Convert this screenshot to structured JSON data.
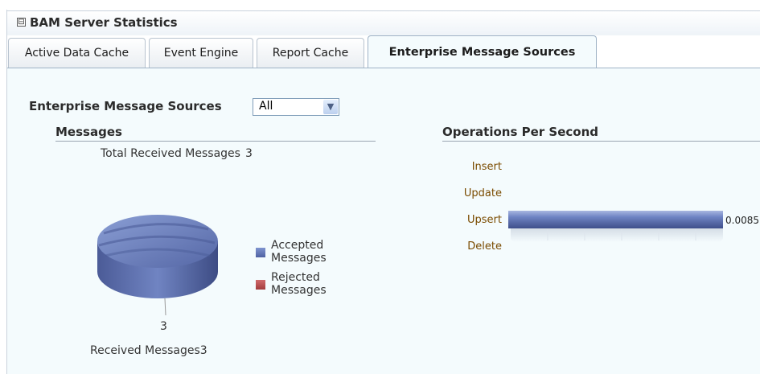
{
  "panel": {
    "title": "BAM Server Statistics",
    "collapse_glyph": "⊟"
  },
  "tabs": [
    {
      "label": "Active Data Cache",
      "selected": false
    },
    {
      "label": "Event Engine",
      "selected": false
    },
    {
      "label": "Report Cache",
      "selected": false
    },
    {
      "label": "Enterprise Message Sources",
      "selected": true
    }
  ],
  "filter": {
    "label": "Enterprise Message Sources",
    "selected_value": "All"
  },
  "messages": {
    "title": "Messages",
    "total_label": "Total Received Messages",
    "total_value": "3",
    "pie_value_label": "3",
    "pie_caption": "Received Messages3",
    "legend": [
      {
        "label": "Accepted Messages",
        "color": "#5b6fae"
      },
      {
        "label": "Rejected Messages",
        "color": "#b5494a"
      }
    ]
  },
  "operations": {
    "title": "Operations Per Second",
    "rows": [
      "Insert",
      "Update",
      "Upsert",
      "Delete"
    ],
    "upsert_value_label": "0.0085"
  },
  "chart_data": [
    {
      "type": "pie",
      "title": "",
      "categories": [
        "Accepted Messages",
        "Rejected Messages"
      ],
      "values": [
        3,
        0
      ]
    },
    {
      "type": "bar",
      "title": "Operations Per Second",
      "categories": [
        "Insert",
        "Update",
        "Upsert",
        "Delete"
      ],
      "values": [
        0,
        0,
        0.0085,
        0
      ],
      "orientation": "horizontal"
    }
  ]
}
